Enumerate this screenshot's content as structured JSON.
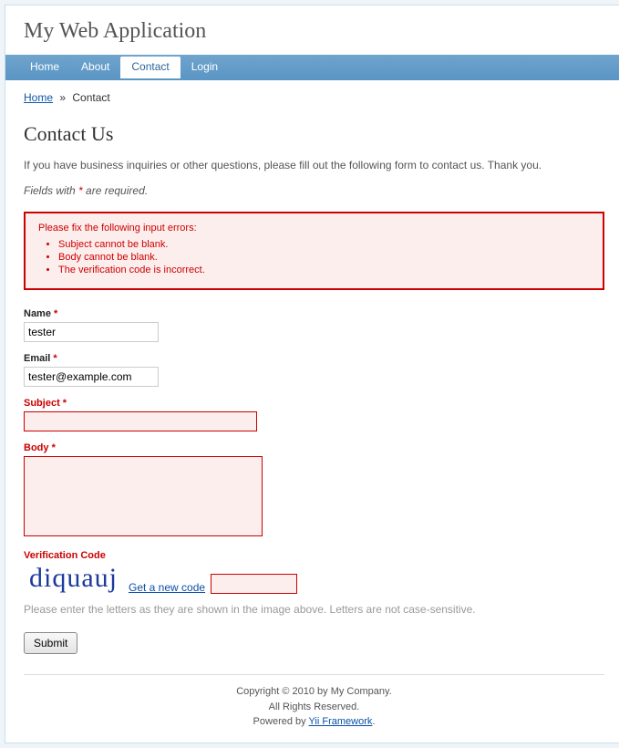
{
  "header": {
    "title": "My Web Application"
  },
  "nav": {
    "items": [
      {
        "label": "Home"
      },
      {
        "label": "About"
      },
      {
        "label": "Contact"
      },
      {
        "label": "Login"
      }
    ],
    "active_index": 2
  },
  "breadcrumb": {
    "home": "Home",
    "sep": "»",
    "current": "Contact"
  },
  "page": {
    "title": "Contact Us",
    "intro": "If you have business inquiries or other questions, please fill out the following form to contact us. Thank you.",
    "required_note_prefix": "Fields with ",
    "required_note_star": "*",
    "required_note_suffix": " are required."
  },
  "errors": {
    "heading": "Please fix the following input errors:",
    "items": [
      "Subject cannot be blank.",
      "Body cannot be blank.",
      "The verification code is incorrect."
    ]
  },
  "form": {
    "name": {
      "label": "Name",
      "value": "tester",
      "required": "*"
    },
    "email": {
      "label": "Email",
      "value": "tester@example.com",
      "required": "*"
    },
    "subject": {
      "label": "Subject",
      "value": "",
      "required": "*"
    },
    "body": {
      "label": "Body",
      "value": "",
      "required": "*"
    },
    "captcha": {
      "label": "Verification Code",
      "image_text": "diquauj",
      "new_code_link": "Get a new code",
      "value": "",
      "hint": "Please enter the letters as they are shown in the image above. Letters are not case-sensitive."
    },
    "submit_label": "Submit"
  },
  "footer": {
    "copyright": "Copyright © 2010 by My Company.",
    "rights": "All Rights Reserved.",
    "powered_prefix": "Powered by ",
    "powered_link": "Yii Framework",
    "powered_suffix": "."
  }
}
